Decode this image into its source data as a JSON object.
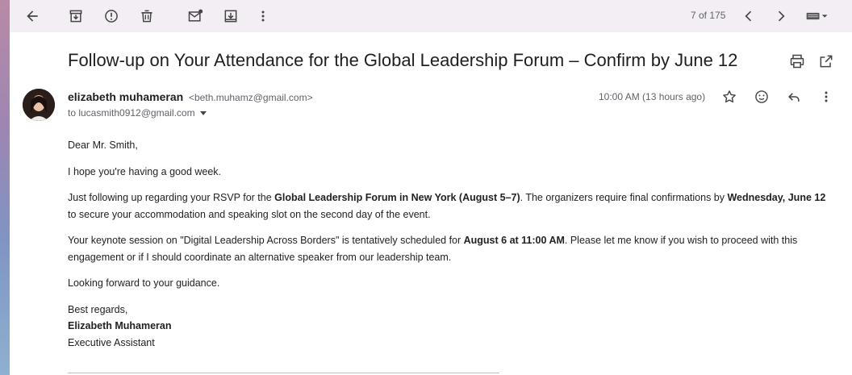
{
  "toolbar": {
    "pager": "7 of 175",
    "icons": [
      "back-arrow-icon",
      "archive-icon",
      "report-spam-icon",
      "delete-icon",
      "mark-unread-icon",
      "move-to-icon",
      "more-vert-icon",
      "chevron-left-icon",
      "chevron-right-icon",
      "keyboard-icon"
    ]
  },
  "email": {
    "subject": "Follow-up on Your Attendance for the Global Leadership Forum – Confirm by June 12",
    "sender_name": "elizabeth muhameran",
    "sender_email": "<beth.muhamz@gmail.com>",
    "to": "to lucasmith0912@gmail.com",
    "time": "10:00 AM (13 hours ago)",
    "body": {
      "greeting": "Dear Mr. Smith,",
      "p1": "I hope you're having a good week.",
      "p2_a": "Just following up regarding your RSVP for the ",
      "p2_b": "Global Leadership Forum in New York (August 5–7)",
      "p2_c": ". The organizers require final confirmations by ",
      "p2_d": "Wednesday, June 12",
      "p2_e": " to secure your accommodation and speaking slot on the second day of the event.",
      "p3_a": "Your keynote session on \"Digital Leadership Across Borders\" is tentatively scheduled for ",
      "p3_b": "August 6 at 11:00 AM",
      "p3_c": ". Please let me know if you wish to proceed with this engagement or if I should coordinate an alternative speaker from our leadership team.",
      "p4": "Looking forward to your guidance.",
      "closing": "Best regards,",
      "sig_name": "Elizabeth Muhameran",
      "sig_title": "Executive Assistant"
    }
  },
  "colors": {
    "toolbar_bg": "#f3eef3",
    "text": "#1f1f1f",
    "muted": "#5f6368"
  }
}
